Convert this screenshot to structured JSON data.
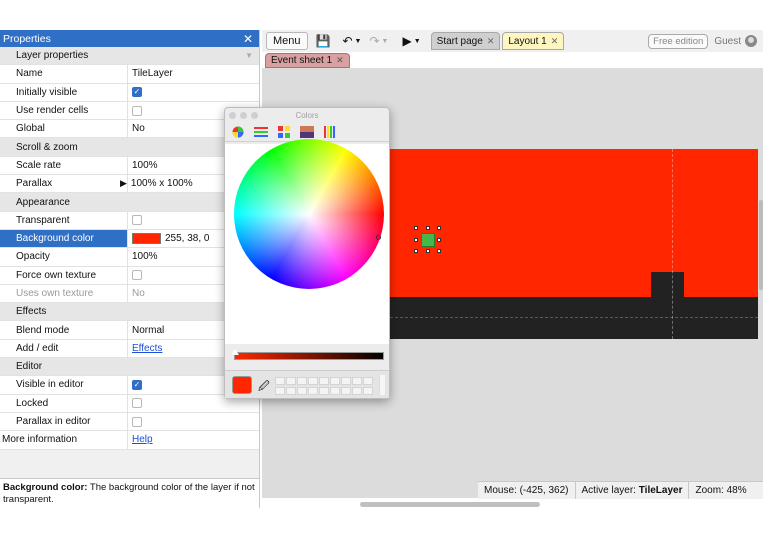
{
  "properties": {
    "title": "Properties",
    "close_icon": "close-icon",
    "rows": [
      {
        "type": "category",
        "label": "Layer properties"
      },
      {
        "type": "text",
        "label": "Name",
        "value": "TileLayer"
      },
      {
        "type": "check",
        "label": "Initially visible",
        "checked": true
      },
      {
        "type": "check",
        "label": "Use render cells",
        "checked": false
      },
      {
        "type": "text",
        "label": "Global",
        "value": "No"
      },
      {
        "type": "category",
        "label": "Scroll & zoom"
      },
      {
        "type": "text",
        "label": "Scale rate",
        "value": "100%"
      },
      {
        "type": "text",
        "label": "Parallax",
        "value": "100% x 100%",
        "expander": true
      },
      {
        "type": "category",
        "label": "Appearance"
      },
      {
        "type": "check",
        "label": "Transparent",
        "checked": false
      },
      {
        "type": "color",
        "label": "Background color",
        "value": "255, 38, 0",
        "color": "#ff2600",
        "selected": true
      },
      {
        "type": "text",
        "label": "Opacity",
        "value": "100%"
      },
      {
        "type": "check",
        "label": "Force own texture",
        "checked": false
      },
      {
        "type": "text",
        "label": "Uses own texture",
        "value": "No",
        "dim": true
      },
      {
        "type": "category",
        "label": "Effects"
      },
      {
        "type": "text",
        "label": "Blend mode",
        "value": "Normal"
      },
      {
        "type": "link",
        "label": "Add / edit",
        "value": "Effects"
      },
      {
        "type": "category",
        "label": "Editor"
      },
      {
        "type": "check",
        "label": "Visible in editor",
        "checked": true
      },
      {
        "type": "check",
        "label": "Locked",
        "checked": false
      },
      {
        "type": "check",
        "label": "Parallax in editor",
        "checked": false
      },
      {
        "type": "link",
        "label": "More information",
        "value": "Help",
        "root": true
      }
    ],
    "help_title": "Background color:",
    "help_text": " The background color of the layer if not transparent."
  },
  "toolbar": {
    "menu_label": "Menu",
    "tabs": [
      {
        "label": "Start page",
        "active": false
      },
      {
        "label": "Layout 1",
        "active": true
      }
    ],
    "free_edition": "Free edition",
    "guest": "Guest"
  },
  "event_tab": {
    "label": "Event sheet 1"
  },
  "status": {
    "mouse": "Mouse: (-425, 362)",
    "active_layer_label": "Active layer:",
    "active_layer": "TileLayer",
    "zoom": "Zoom: 48%"
  },
  "colors_window": {
    "title": "Colors",
    "current_color": "#ff2600",
    "tools": [
      "color-wheel-icon",
      "color-sliders-icon",
      "color-palettes-icon",
      "image-palettes-icon",
      "pencils-icon"
    ]
  },
  "canvas": {
    "layer_color": "#ff2600",
    "ground_color": "#222222",
    "sprite_color": "#44b84a"
  }
}
